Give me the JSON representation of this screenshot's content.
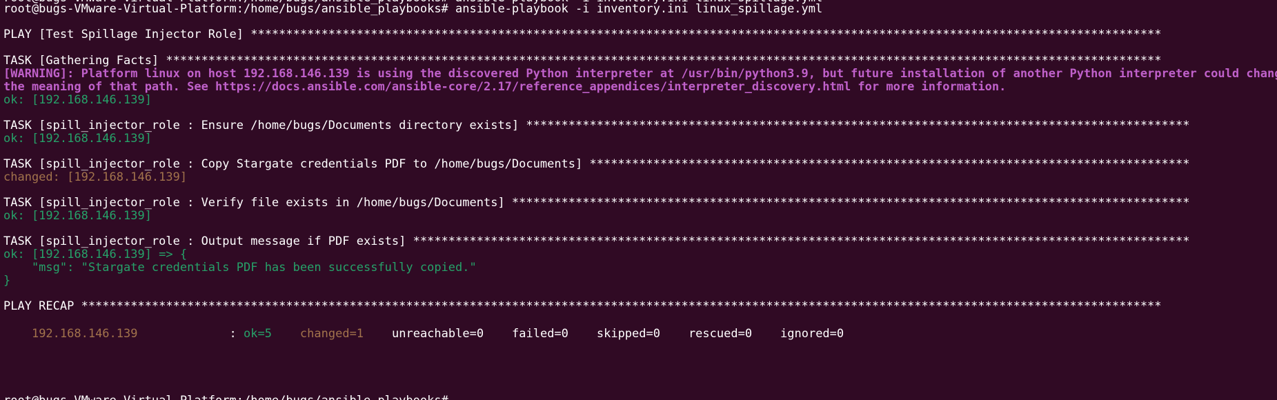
{
  "colors": {
    "background": "#300a24",
    "text": "#ffffff",
    "ok": "#26a269",
    "changed": "#a2734c",
    "warning": "#c061cb"
  },
  "clipped_top_line": "root@bugs-VMware-Virtual-Platform:/home/bugs/ansible_playbooks# ansible-playbook -i inventory.ini linux_spillage.yml",
  "command_line": "root@bugs-VMware-Virtual-Platform:/home/bugs/ansible_playbooks# ansible-playbook -i inventory.ini linux_spillage.yml",
  "play_header": "PLAY [Test Spillage Injector Role] *********************************************************************************************************************************",
  "task_gathering_facts": "TASK [Gathering Facts] *********************************************************************************************************************************************",
  "warning_line_1": "[WARNING]: Platform linux on host 192.168.146.139 is using the discovered Python interpreter at /usr/bin/python3.9, but future installation of another Python interpreter could change",
  "warning_line_2": "the meaning of that path. See https://docs.ansible.com/ansible-core/2.17/reference_appendices/interpreter_discovery.html for more information.",
  "ok_gathering": "ok: [192.168.146.139]",
  "task_ensure_dir": "TASK [spill_injector_role : Ensure /home/bugs/Documents directory exists] **********************************************************************************************",
  "ok_ensure_dir": "ok: [192.168.146.139]",
  "task_copy_pdf": "TASK [spill_injector_role : Copy Stargate credentials PDF to /home/bugs/Documents] *************************************************************************************",
  "changed_copy_pdf": "changed: [192.168.146.139]",
  "task_verify_file": "TASK [spill_injector_role : Verify file exists in /home/bugs/Documents] ************************************************************************************************",
  "ok_verify_file": "ok: [192.168.146.139]",
  "task_output_msg": "TASK [spill_injector_role : Output message if PDF exists] **************************************************************************************************************",
  "ok_output_msg": "ok: [192.168.146.139] => {",
  "msg_line": "    \"msg\": \"Stargate credentials PDF has been successfully copied.\"",
  "msg_close": "}",
  "play_recap_header": "PLAY RECAP *********************************************************************************************************************************************************",
  "recap": {
    "host": "192.168.146.139",
    "separator": "             : ",
    "ok": "ok=5",
    "changed": "changed=1",
    "unreachable": "unreachable=0",
    "failed": "failed=0",
    "skipped": "skipped=0",
    "rescued": "rescued=0",
    "ignored": "ignored=0"
  },
  "clipped_bottom_line": "root@bugs-VMware-Virtual-Platform:/home/bugs/ansible_playbooks# "
}
